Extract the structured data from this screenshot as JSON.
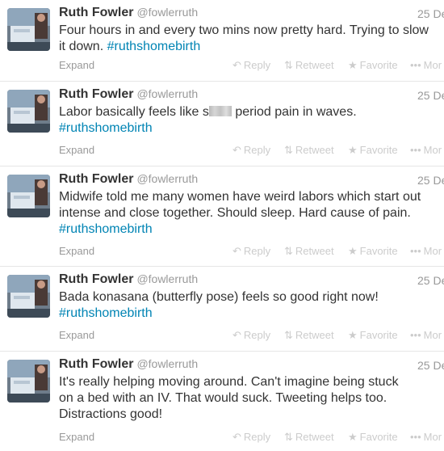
{
  "tweets": [
    {
      "name": "Ruth Fowler",
      "handle": "@fowlerruth",
      "time": "25 De",
      "text_parts": [
        "Four hours in and every two mins now pretty hard. Trying to slow it down. "
      ],
      "hashtag": "#ruthshomebirth",
      "hashtag_inline": true,
      "expand": "Expand"
    },
    {
      "name": "Ruth Fowler",
      "handle": "@fowlerruth",
      "time": "25 De",
      "text_before": "Labor basically feels like s",
      "text_after": " period pain in waves.",
      "hashtag": "#ruthshomebirth",
      "expand": "Expand"
    },
    {
      "name": "Ruth Fowler",
      "handle": "@fowlerruth",
      "time": "25 De",
      "text_parts": [
        "Midwife told me many women have weird labors which start out intense and close together. Should sleep. Hard cause of pain."
      ],
      "hashtag": "#ruthshomebirth",
      "expand": "Expand"
    },
    {
      "name": "Ruth Fowler",
      "handle": "@fowlerruth",
      "time": "25 De",
      "text_parts": [
        "Bada konasana (butterfly pose) feels so good right now!"
      ],
      "hashtag": "#ruthshomebirth",
      "expand": "Expand"
    },
    {
      "name": "Ruth Fowler",
      "handle": "@fowlerruth",
      "time": "25 De",
      "text_parts": [
        "It's really helping moving around. Can't imagine being stuck on a bed with an IV. That would suck. Tweeting helps too. Distractions good!"
      ],
      "expand": "Expand"
    }
  ],
  "actions": {
    "reply": "Reply",
    "retweet": "Retweet",
    "favorite": "Favorite",
    "more": "Mor"
  },
  "icons": {
    "reply": "reply-arrow-icon",
    "retweet": "retweet-icon",
    "favorite": "star-icon",
    "more": "more-dots-icon"
  },
  "colors": {
    "hashtag": "#0084b4",
    "name": "#333333",
    "muted": "#999999",
    "action": "#cccccc"
  }
}
